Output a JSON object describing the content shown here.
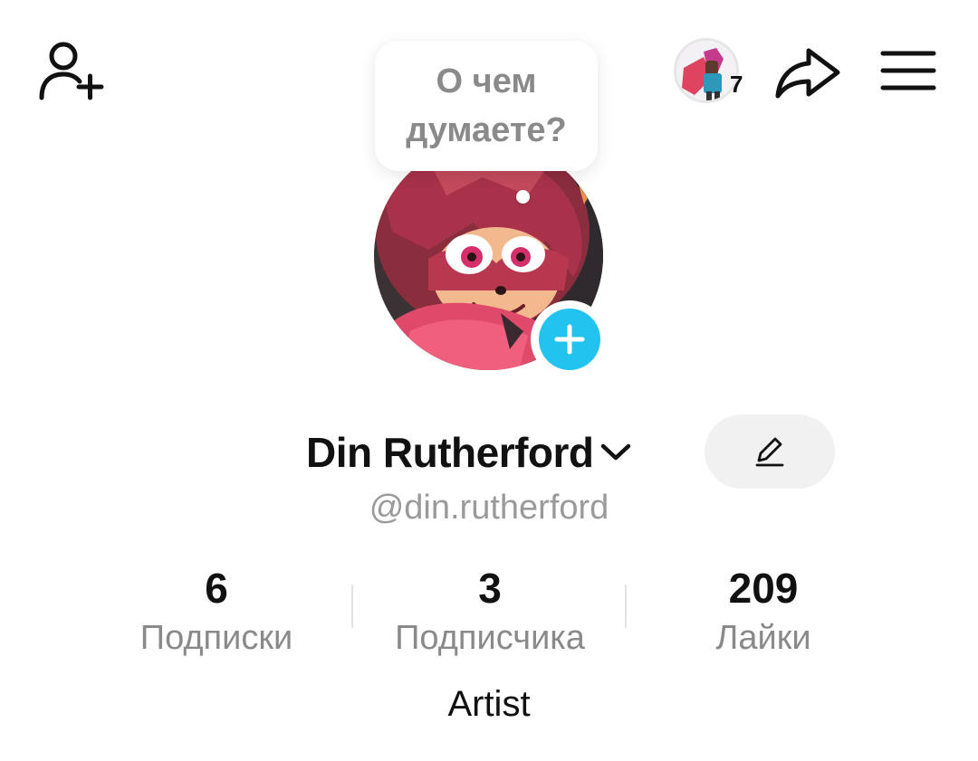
{
  "header": {
    "add_friend_icon": "person-plus-icon",
    "story_count": "7",
    "share_icon": "share-arrow-icon",
    "menu_icon": "hamburger-menu-icon"
  },
  "thought_bubble": {
    "text": "О чем думаете?"
  },
  "profile": {
    "display_name": "Din Rutherford",
    "username": "@din.rutherford",
    "bio": "Artist",
    "accent_color": "#22c3ee"
  },
  "stats": [
    {
      "value": "6",
      "label": "Подписки"
    },
    {
      "value": "3",
      "label": "Подписчика"
    },
    {
      "value": "209",
      "label": "Лайки"
    }
  ]
}
